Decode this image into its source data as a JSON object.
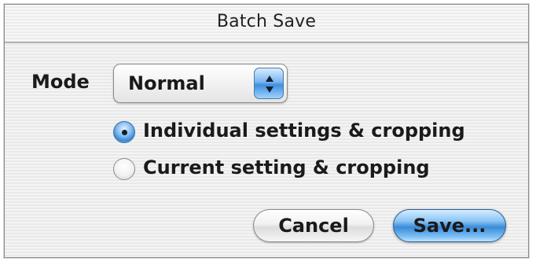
{
  "dialog": {
    "title": "Batch Save"
  },
  "mode": {
    "label": "Mode",
    "selected_value": "Normal"
  },
  "options": [
    {
      "label": "Individual settings & cropping",
      "selected": true
    },
    {
      "label": "Current setting & cropping",
      "selected": false
    }
  ],
  "buttons": {
    "cancel_label": "Cancel",
    "save_label": "Save..."
  },
  "colors": {
    "accent_blue": "#3b88d6",
    "window_stripe_light": "#f4f4f4",
    "window_stripe_dark": "#e9e9e9",
    "text": "#1a1a1a"
  }
}
